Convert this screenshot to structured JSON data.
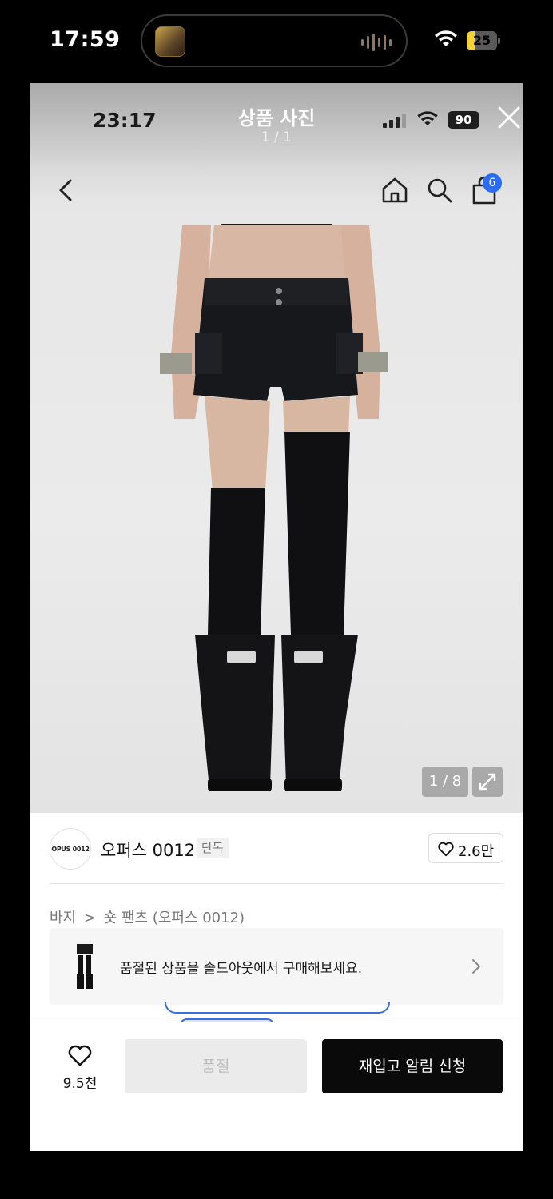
{
  "outer_status": {
    "time": "17:59",
    "battery": "25"
  },
  "inner_status": {
    "time": "23:17",
    "battery": "90"
  },
  "viewer": {
    "title": "상품 사진",
    "count": "1 / 1",
    "photo_counter": "1 / 8"
  },
  "header": {
    "cart_badge": "6"
  },
  "brand": {
    "logo_text": "OPUS 0012",
    "name": "오퍼스 0012",
    "tag": "단독",
    "likes": "2.6만"
  },
  "breadcrumb": {
    "category": "바지",
    "separator": ">",
    "subcategory": "숏 팬츠 (오퍼스 0012)"
  },
  "soldout_banner": {
    "text": "품절된 상품을 솔드아웃에서 구매해보세요."
  },
  "bottom_bar": {
    "wish_count": "9.5천",
    "soldout_label": "품절",
    "restock_label": "재입고 알림 신청"
  },
  "colors": {
    "accent": "#2b6cf6",
    "dark": "#0a0a0a",
    "battery": "#f3d23b"
  }
}
